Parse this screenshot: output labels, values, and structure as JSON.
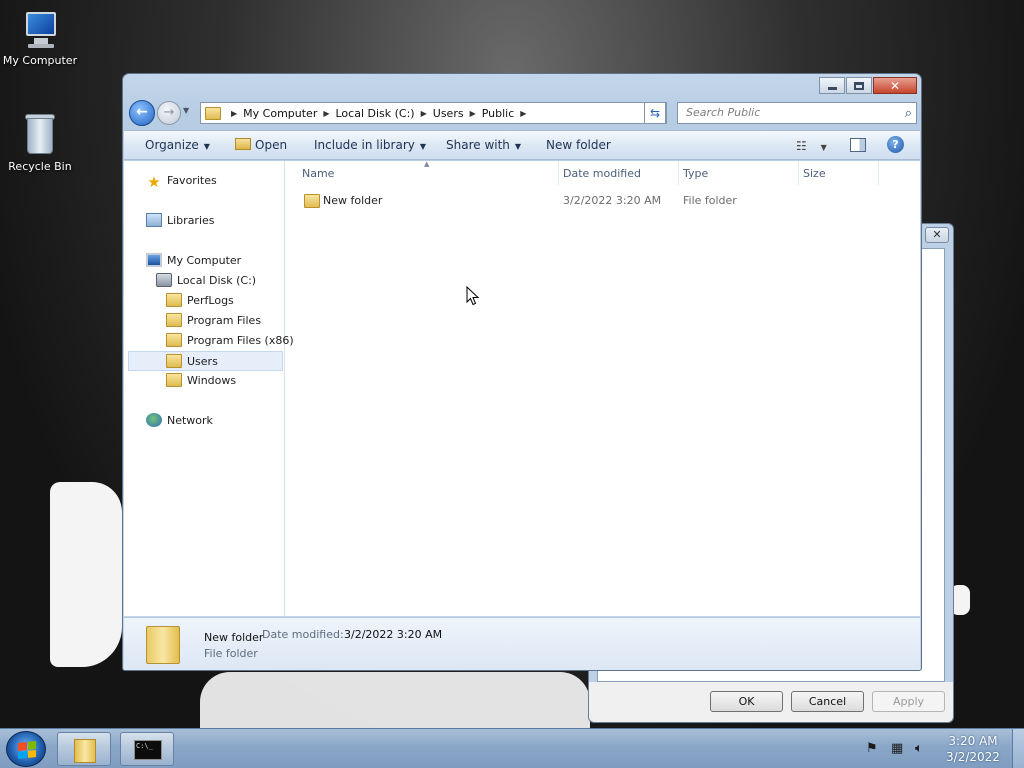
{
  "desktop": {
    "icons": [
      {
        "label": "My Computer"
      },
      {
        "label": "Recycle Bin"
      }
    ]
  },
  "explorer": {
    "address": {
      "crumbs": [
        "My Computer",
        "Local Disk (C:)",
        "Users",
        "Public"
      ]
    },
    "search": {
      "placeholder": "Search Public"
    },
    "toolbar": {
      "organize": "Organize",
      "open": "Open",
      "include_in_library": "Include in library",
      "share_with": "Share with",
      "new_folder": "New folder"
    },
    "nav": {
      "favorites": "Favorites",
      "libraries": "Libraries",
      "my_computer": "My Computer",
      "local_disk": "Local Disk (C:)",
      "folders": [
        "PerfLogs",
        "Program Files",
        "Program Files (x86)",
        "Users",
        "Windows"
      ],
      "selected": "Users",
      "network": "Network"
    },
    "columns": {
      "name": "Name",
      "date_modified": "Date modified",
      "type": "Type",
      "size": "Size"
    },
    "files": [
      {
        "name": "New folder",
        "date_modified": "3/2/2022 3:20 AM",
        "type": "File folder",
        "size": ""
      }
    ],
    "details": {
      "name": "New folder",
      "type": "File folder",
      "date_label": "Date modified:",
      "date_value": "3/2/2022 3:20 AM"
    }
  },
  "background_dialog": {
    "ok": "OK",
    "cancel": "Cancel",
    "apply": "Apply"
  },
  "taskbar": {
    "time": "3:20 AM",
    "date": "3/2/2022",
    "cmd_text": "C:\\_"
  }
}
